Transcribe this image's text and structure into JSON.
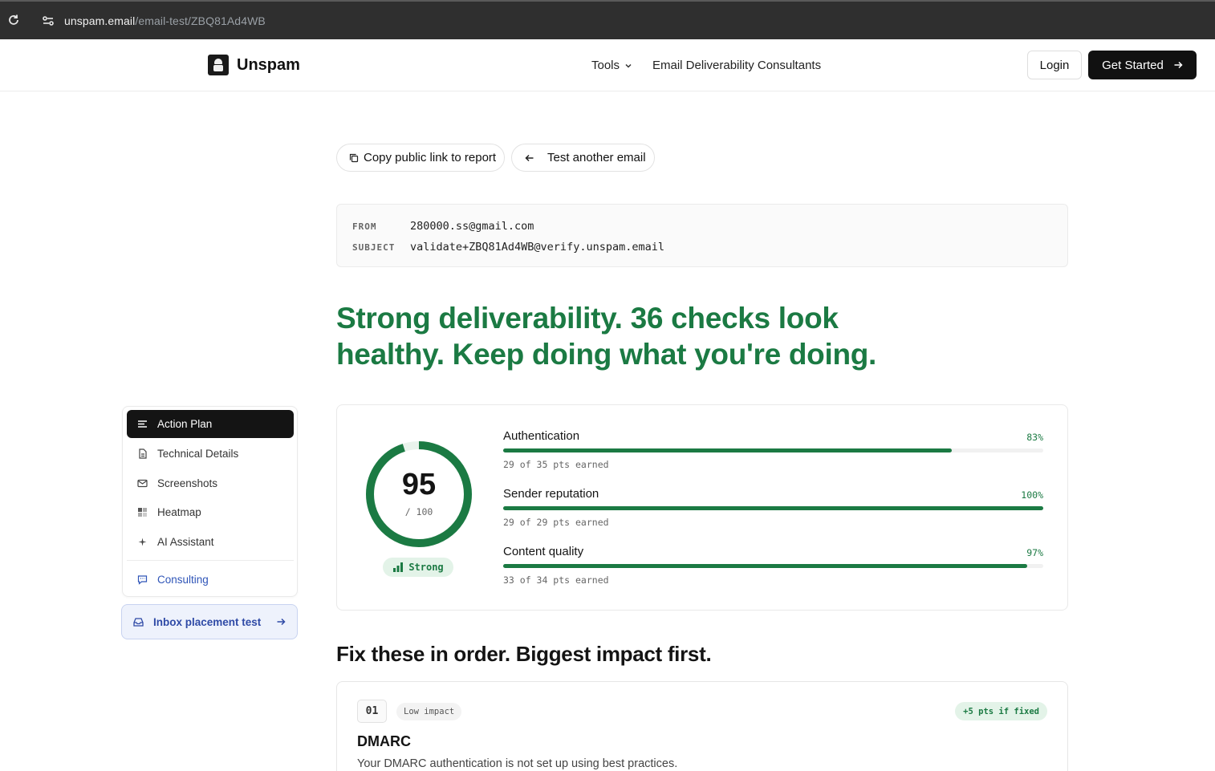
{
  "browser": {
    "url_host": "unspam.email",
    "url_path": "/email-test/ZBQ81Ad4WB"
  },
  "header": {
    "brand": "Unspam",
    "nav_tools": "Tools",
    "nav_consultants": "Email Deliverability Consultants",
    "login": "Login",
    "get_started": "Get Started"
  },
  "actions": {
    "copy_link": "Copy public link to report",
    "test_another": "Test another email"
  },
  "meta": {
    "from_label": "FROM",
    "from_value": "280000.ss@gmail.com",
    "subject_label": "SUBJECT",
    "subject_value": "validate+ZBQ81Ad4WB@verify.unspam.email"
  },
  "headline": "Strong deliverability. 36 checks look healthy. Keep doing what you're doing.",
  "sidebar": {
    "items": [
      {
        "label": "Action Plan",
        "icon": "list-icon"
      },
      {
        "label": "Technical Details",
        "icon": "document-icon"
      },
      {
        "label": "Screenshots",
        "icon": "mail-icon"
      },
      {
        "label": "Heatmap",
        "icon": "grid-icon"
      },
      {
        "label": "AI Assistant",
        "icon": "sparkle-icon"
      }
    ],
    "consulting": "Consulting",
    "inbox_test": "Inbox placement test"
  },
  "score": {
    "value": "95",
    "denominator": "/ 100",
    "fraction": 0.95,
    "badge": "Strong",
    "metrics": [
      {
        "name": "Authentication",
        "pct": "83%",
        "fraction": 0.83,
        "pts": "29 of 35 pts earned"
      },
      {
        "name": "Sender reputation",
        "pct": "100%",
        "fraction": 1.0,
        "pts": "29 of 29 pts earned"
      },
      {
        "name": "Content quality",
        "pct": "97%",
        "fraction": 0.97,
        "pts": "33 of 34 pts earned"
      }
    ]
  },
  "fix": {
    "title": "Fix these in order. Biggest impact first.",
    "issues": [
      {
        "number": "01",
        "impact": "Low impact",
        "pts": "+5 pts if fixed",
        "name": "DMARC",
        "description": "Your DMARC authentication is not set up using best practices."
      }
    ]
  },
  "colors": {
    "accent_green": "#1b7a43",
    "dark": "#141414",
    "consult_blue": "#2f55b8"
  }
}
